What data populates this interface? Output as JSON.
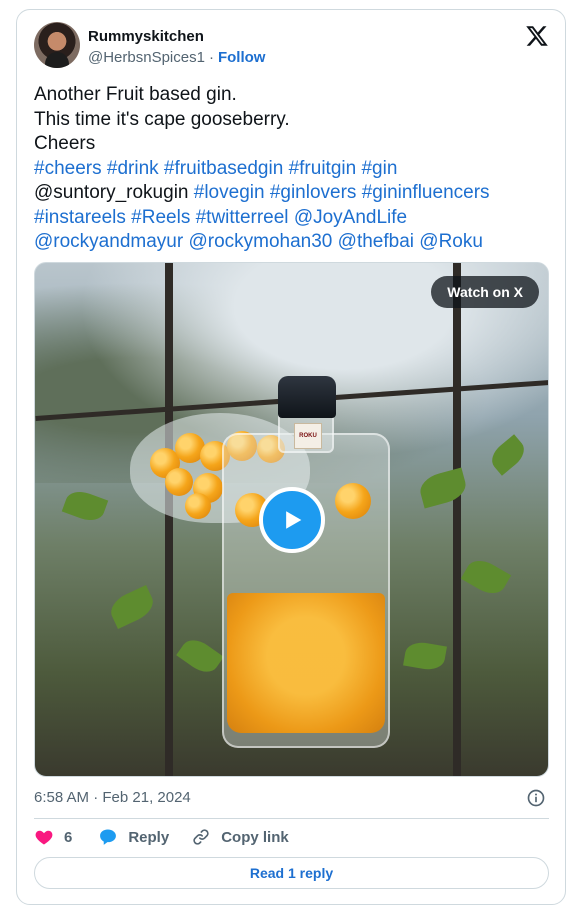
{
  "author": {
    "display_name": "Rummyskitchen",
    "handle": "@HerbsnSpices1",
    "separator": "·",
    "follow_label": "Follow"
  },
  "tweet": {
    "lines": [
      [
        {
          "text": "Another Fruit based gin.",
          "link": false
        }
      ],
      [
        {
          "text": "This time it's cape gooseberry.",
          "link": false
        }
      ],
      [
        {
          "text": "Cheers",
          "link": false
        }
      ],
      [
        {
          "text": "#cheers",
          "link": true
        },
        {
          "text": " ",
          "link": false
        },
        {
          "text": "#drink",
          "link": true
        },
        {
          "text": " ",
          "link": false
        },
        {
          "text": "#fruitbasedgin",
          "link": true
        },
        {
          "text": " ",
          "link": false
        },
        {
          "text": "#fruitgin",
          "link": true
        },
        {
          "text": " ",
          "link": false
        },
        {
          "text": "#gin",
          "link": true
        }
      ],
      [
        {
          "text": "@suntory_rokugin ",
          "link": false
        },
        {
          "text": "#lovegin",
          "link": true
        },
        {
          "text": " ",
          "link": false
        },
        {
          "text": "#ginlovers",
          "link": true
        },
        {
          "text": " ",
          "link": false
        },
        {
          "text": "#gininfluencers",
          "link": true
        }
      ],
      [
        {
          "text": "#instareels",
          "link": true
        },
        {
          "text": " ",
          "link": false
        },
        {
          "text": "#Reels",
          "link": true
        },
        {
          "text": " ",
          "link": false
        },
        {
          "text": "#twitterreel",
          "link": true
        },
        {
          "text": " ",
          "link": false
        },
        {
          "text": "@JoyAndLife",
          "link": true
        }
      ],
      [
        {
          "text": "@rockyandmayur",
          "link": true
        },
        {
          "text": " ",
          "link": false
        },
        {
          "text": "@rockymohan30",
          "link": true
        },
        {
          "text": " ",
          "link": false
        },
        {
          "text": "@thefbai",
          "link": true
        },
        {
          "text": " ",
          "link": false
        },
        {
          "text": "@Roku",
          "link": true
        }
      ]
    ]
  },
  "media": {
    "watch_label": "Watch on X",
    "bottle_label": "ROKU"
  },
  "meta": {
    "timestamp": "6:58 AM · Feb 21, 2024"
  },
  "actions": {
    "like_count": "6",
    "reply_label": "Reply",
    "copy_link_label": "Copy link",
    "read_replies_label": "Read 1 reply"
  },
  "icons": {
    "x_logo": "x-logo-icon",
    "heart": "heart-icon",
    "reply": "reply-bubble-icon",
    "copy_link": "link-icon",
    "info": "info-icon",
    "play": "play-icon"
  },
  "colors": {
    "link": "#1d6fd0",
    "like": "#f91880",
    "reply": "#1d9bf0",
    "muted": "#536471",
    "border": "#cfd9de"
  }
}
